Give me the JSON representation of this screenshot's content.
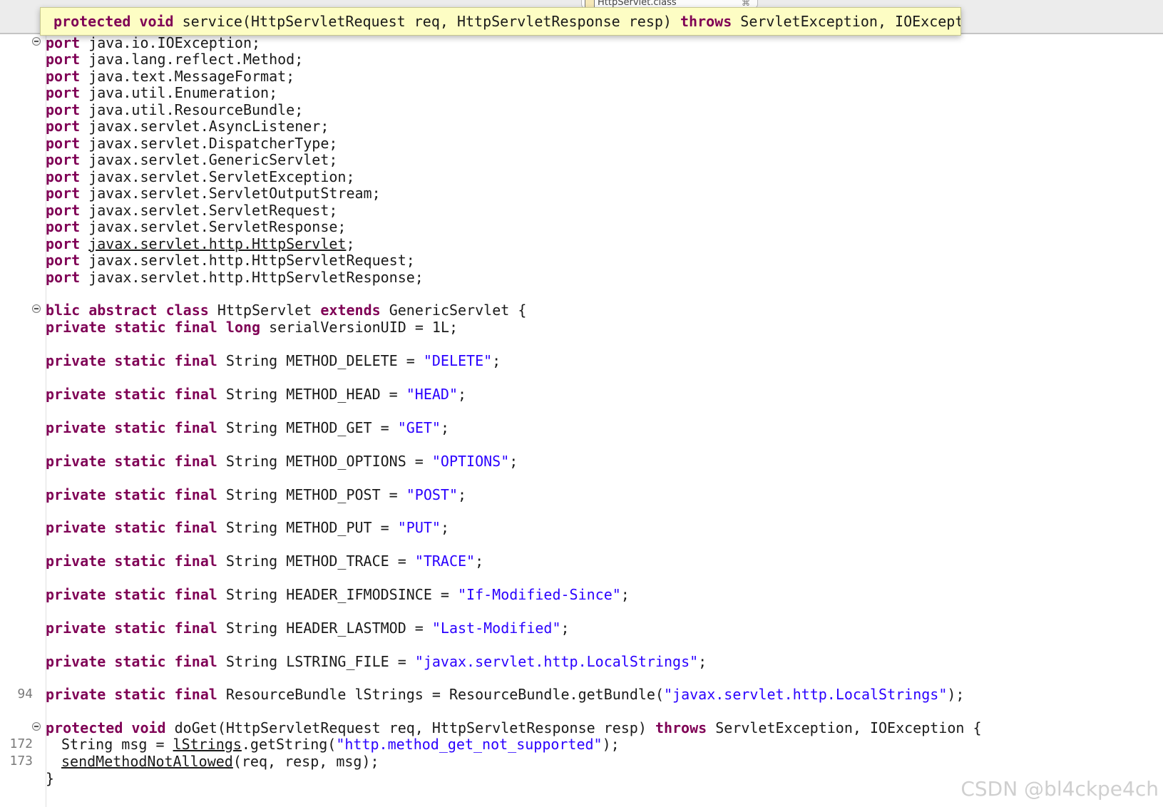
{
  "tab": {
    "label": "HttpServlet.class",
    "close": "⌘"
  },
  "tooltip": {
    "k_protected": "protected",
    "k_void": "void",
    "t1": " service(HttpServletRequest req, HttpServletResponse resp) ",
    "k_throws": "throws",
    "t2": " ServletException, IOException {"
  },
  "kw": {
    "port": "port",
    "blic": "blic",
    "abstract": "abstract",
    "class": "class",
    "extends": "extends",
    "private": "private",
    "static": "static",
    "final": "final",
    "long": "long",
    "protected": "protected",
    "void": "void",
    "throws": "throws"
  },
  "imports": [
    " java.io.IOException;",
    " java.lang.reflect.Method;",
    " java.text.MessageFormat;",
    " java.util.Enumeration;",
    " java.util.ResourceBundle;",
    " javax.servlet.AsyncListener;",
    " javax.servlet.DispatcherType;",
    " javax.servlet.GenericServlet;",
    " javax.servlet.ServletException;",
    " javax.servlet.ServletOutputStream;",
    " javax.servlet.ServletRequest;",
    " javax.servlet.ServletResponse;",
    "javax.servlet.http.HttpServlet",
    " javax.servlet.http.HttpServletRequest;",
    " javax.servlet.http.HttpServletResponse;"
  ],
  "import_suffix": ";",
  "class_decl": {
    "name": " HttpServlet ",
    "super": " GenericServlet {"
  },
  "serial": " serialVersionUID = 1L;",
  "string_type": " String ",
  "fields": [
    {
      "name": "METHOD_DELETE = ",
      "value": "\"DELETE\""
    },
    {
      "name": "METHOD_HEAD = ",
      "value": "\"HEAD\""
    },
    {
      "name": "METHOD_GET = ",
      "value": "\"GET\""
    },
    {
      "name": "METHOD_OPTIONS = ",
      "value": "\"OPTIONS\""
    },
    {
      "name": "METHOD_POST = ",
      "value": "\"POST\""
    },
    {
      "name": "METHOD_PUT = ",
      "value": "\"PUT\""
    },
    {
      "name": "METHOD_TRACE = ",
      "value": "\"TRACE\""
    },
    {
      "name": "HEADER_IFMODSINCE = ",
      "value": "\"If-Modified-Since\""
    },
    {
      "name": "HEADER_LASTMOD = ",
      "value": "\"Last-Modified\""
    },
    {
      "name": "LSTRING_FILE = ",
      "value": "\"javax.servlet.http.LocalStrings\""
    }
  ],
  "semicolon": ";",
  "bundle_line": {
    "number": "94",
    "t1": " ResourceBundle lStrings = ResourceBundle.getBundle(",
    "value": "\"javax.servlet.http.LocalStrings\"",
    "t2": ");"
  },
  "doget": {
    "t1": " doGet(HttpServletRequest req, HttpServletResponse resp) ",
    "t2": " ServletException, IOException {"
  },
  "line172": {
    "number": "172",
    "t1": "String msg = ",
    "link": "lStrings",
    "t2": ".getString(",
    "value": "\"http.method_get_not_supported\"",
    "t3": ");"
  },
  "line173": {
    "number": "173",
    "link": "sendMethodNotAllowed",
    "t2": "(req, resp, msg);"
  },
  "closing": "}",
  "watermark": "CSDN @bl4ckpe4ch"
}
